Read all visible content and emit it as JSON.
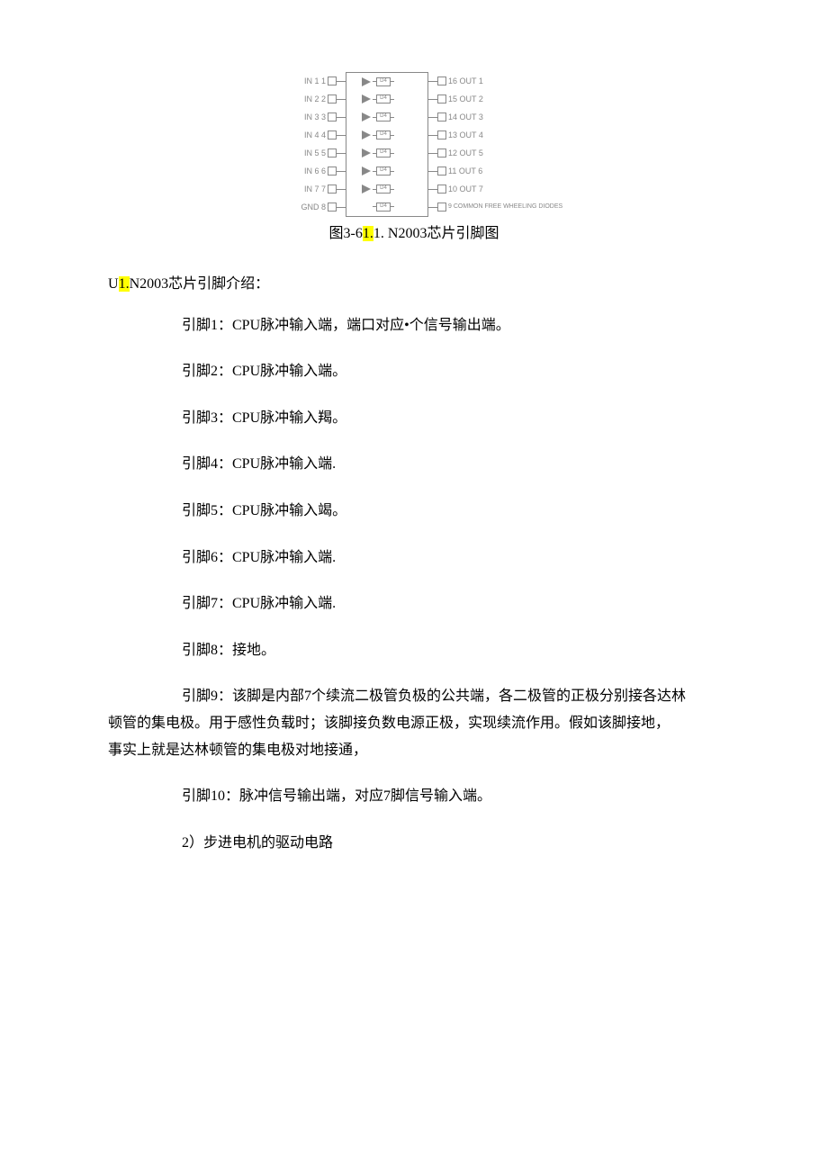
{
  "chip": {
    "left": [
      {
        "name": "IN 1",
        "num": "1"
      },
      {
        "name": "IN 2",
        "num": "2"
      },
      {
        "name": "IN 3",
        "num": "3"
      },
      {
        "name": "IN 4",
        "num": "4"
      },
      {
        "name": "IN 5",
        "num": "5"
      },
      {
        "name": "IN 6",
        "num": "6"
      },
      {
        "name": "IN 7",
        "num": "7"
      },
      {
        "name": "GND",
        "num": "8"
      }
    ],
    "right": [
      {
        "num": "16",
        "name": "OUT 1"
      },
      {
        "num": "15",
        "name": "OUT 2"
      },
      {
        "num": "14",
        "name": "OUT 3"
      },
      {
        "num": "13",
        "name": "OUT 4"
      },
      {
        "num": "12",
        "name": "OUT 5"
      },
      {
        "num": "11",
        "name": "OUT 6"
      },
      {
        "num": "10",
        "name": "OUT 7"
      },
      {
        "num": "9",
        "name": "COMMON FREE WHEELING DIODES"
      }
    ],
    "diode_label": "D4"
  },
  "caption": {
    "pre": "图3-6",
    "hl": "1.",
    "post": "1. N2003芯片引脚图"
  },
  "intro": {
    "pre": "U",
    "hl": "1.",
    "post": "N2003芯片引脚介绍："
  },
  "pins": {
    "p1": "引脚1：CPU脉冲输入端，端口对应•个信号输出端。",
    "p2": "引脚2：CPU脉冲输入端。",
    "p3": "引脚3：CPU脉冲输入羯。",
    "p4": "引脚4：CPU脉冲输入端.",
    "p5": "引脚5：CPU脉冲输入竭。",
    "p6": "引脚6：CPU脉冲输入端.",
    "p7": "引脚7：CPU脉冲输入端.",
    "p8": "引脚8：接地。",
    "p9a": "引脚9：该脚是内部7个续流二极管负极的公共端，各二极管的正极分别接各达林",
    "p9b": "顿管的集电极。用于感性负载时；该脚接负数电源正极，实现续流作用。假如该脚接地，",
    "p9c": "事实上就是达林顿管的集电极对地接通，",
    "p10": "引脚10：脉冲信号输出端，对应7脚信号输入端。"
  },
  "section2": "2）步进电机的驱动电路"
}
